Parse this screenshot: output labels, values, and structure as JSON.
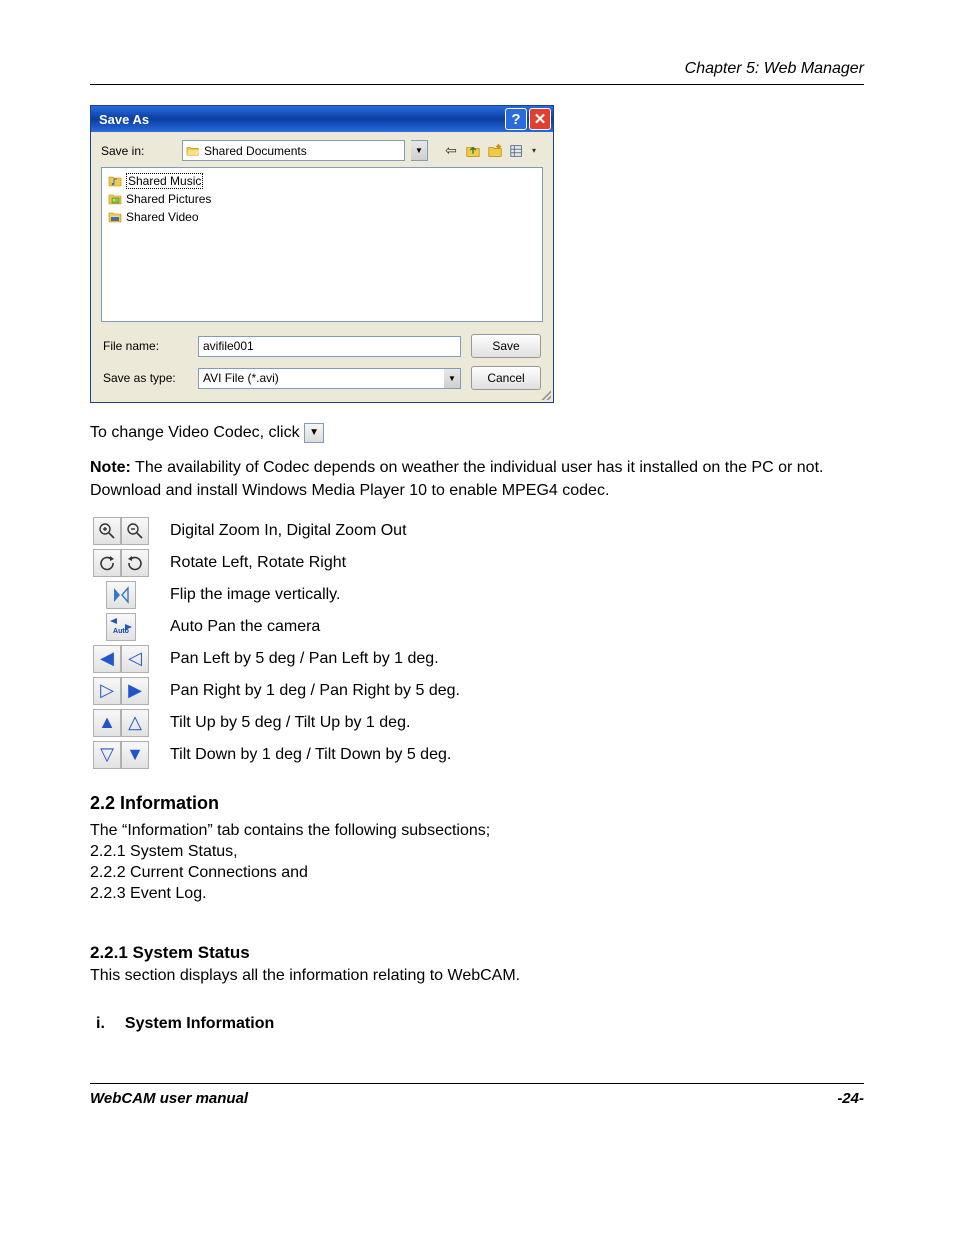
{
  "header": {
    "chapter": "Chapter 5: Web Manager"
  },
  "dialog": {
    "title": "Save As",
    "save_in_label": "Save in:",
    "save_in_value": "Shared Documents",
    "files": [
      {
        "name": "Shared Music",
        "selected": true
      },
      {
        "name": "Shared Pictures",
        "selected": false
      },
      {
        "name": "Shared Video",
        "selected": false
      }
    ],
    "file_name_label": "File name:",
    "file_name_value": "avifile001",
    "save_as_type_label": "Save as type:",
    "save_as_type_value": "AVI File (*.avi)",
    "save_button": "Save",
    "cancel_button": "Cancel"
  },
  "text": {
    "codec_line_prefix": "To change Video Codec, click ",
    "note_bold": "Note:",
    "note_body": " The availability of Codec depends on weather the individual user has it installed on the PC or not. Download and install Windows Media Player 10 to enable MPEG4 codec."
  },
  "icon_rows": [
    {
      "name": "zoom",
      "desc": "Digital Zoom In, Digital Zoom Out"
    },
    {
      "name": "rotate",
      "desc": "Rotate Left, Rotate Right"
    },
    {
      "name": "flip",
      "desc": "Flip the image vertically."
    },
    {
      "name": "autopan",
      "desc": "Auto Pan the camera"
    },
    {
      "name": "panleft",
      "desc": "Pan Left by 5 deg / Pan Left by 1 deg."
    },
    {
      "name": "panright",
      "desc": "Pan Right by 1 deg / Pan Right by 5 deg."
    },
    {
      "name": "tiltup",
      "desc": "Tilt Up by 5 deg / Tilt Up by 1 deg."
    },
    {
      "name": "tiltdown",
      "desc": "Tilt Down by 1 deg / Tilt Down by 5 deg."
    }
  ],
  "sections": {
    "info_h": "2.2 Information",
    "info_intro": "The “Information” tab contains the following subsections;",
    "info_items": [
      "2.2.1 System Status,",
      "2.2.2 Current Connections and",
      "2.2.3 Event Log."
    ],
    "status_h": "2.2.1 System Status",
    "status_body": "This section displays all the information relating to WebCAM.",
    "roman_i": "i.",
    "sysinfo_h": "System Information"
  },
  "footer": {
    "left": "WebCAM user manual",
    "right": "-24-"
  }
}
